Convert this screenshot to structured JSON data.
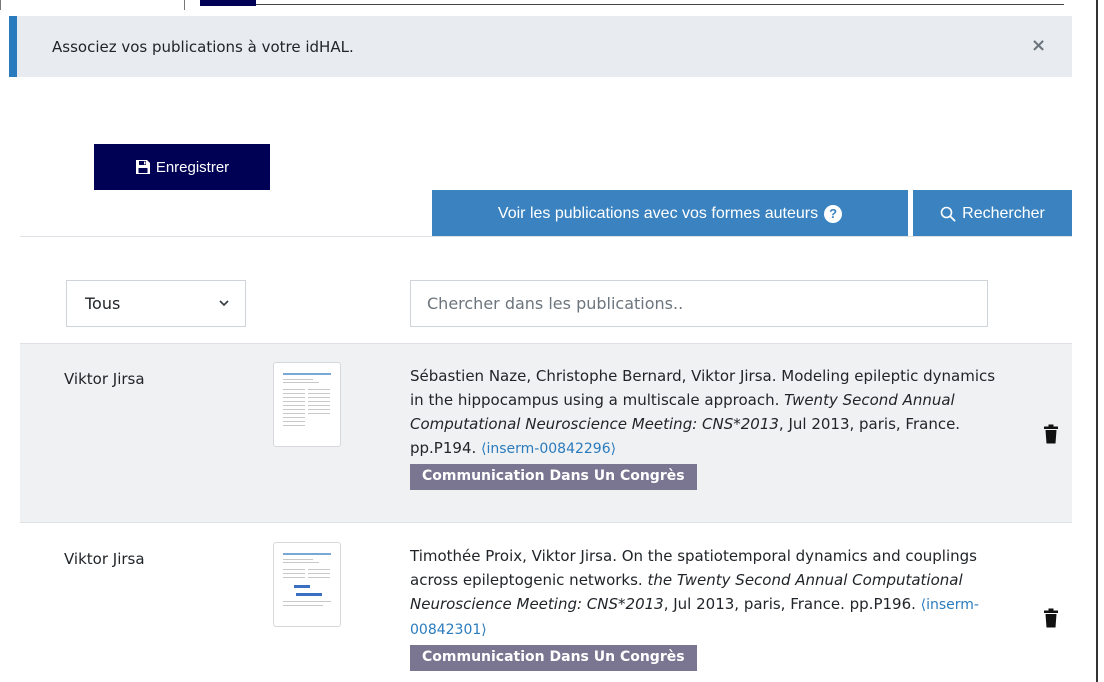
{
  "alert": {
    "message": "Associez vos publications à votre idHAL.",
    "close": "×"
  },
  "toolbar": {
    "save_label": "Enregistrer",
    "authors_label": "Voir les publications avec vos formes auteurs",
    "search_label": "Rechercher"
  },
  "filters": {
    "select_value": "Tous",
    "search_placeholder": "Chercher dans les publications.."
  },
  "publications": [
    {
      "author": "Viktor Jirsa",
      "text_before": "Sébastien Naze, Christophe Bernard, Viktor Jirsa. Modeling epileptic dynamics in the hippocampus using a multiscale approach. ",
      "venue": "Twenty Second Annual Computational Neuroscience Meeting: CNS*2013",
      "text_after": ", Jul 2013, paris, France. pp.P194. ",
      "hal_id": "⟨inserm-00842296⟩",
      "type": "Communication Dans Un Congrès"
    },
    {
      "author": "Viktor Jirsa",
      "text_before": "Timothée Proix, Viktor Jirsa. On the spatiotemporal dynamics and couplings across epileptogenic networks. ",
      "venue": "the Twenty Second Annual Computational Neuroscience Meeting: CNS*2013",
      "text_after": ", Jul 2013, paris, France. pp.P196. ",
      "hal_id": "⟨inserm-00842301⟩",
      "type": "Communication Dans Un Congrès"
    }
  ],
  "icons": {
    "save": "floppy-disk-icon",
    "help": "question-circle-icon",
    "search": "search-icon",
    "chevron": "chevron-down-icon",
    "delete": "trash-icon"
  },
  "colors": {
    "primary_dark": "#000054",
    "primary_blue": "#3a83c0",
    "badge": "#7a7591",
    "alert_bg": "#e8ecf0",
    "alert_border": "#2a7bbd",
    "link": "#2a7bbd"
  }
}
